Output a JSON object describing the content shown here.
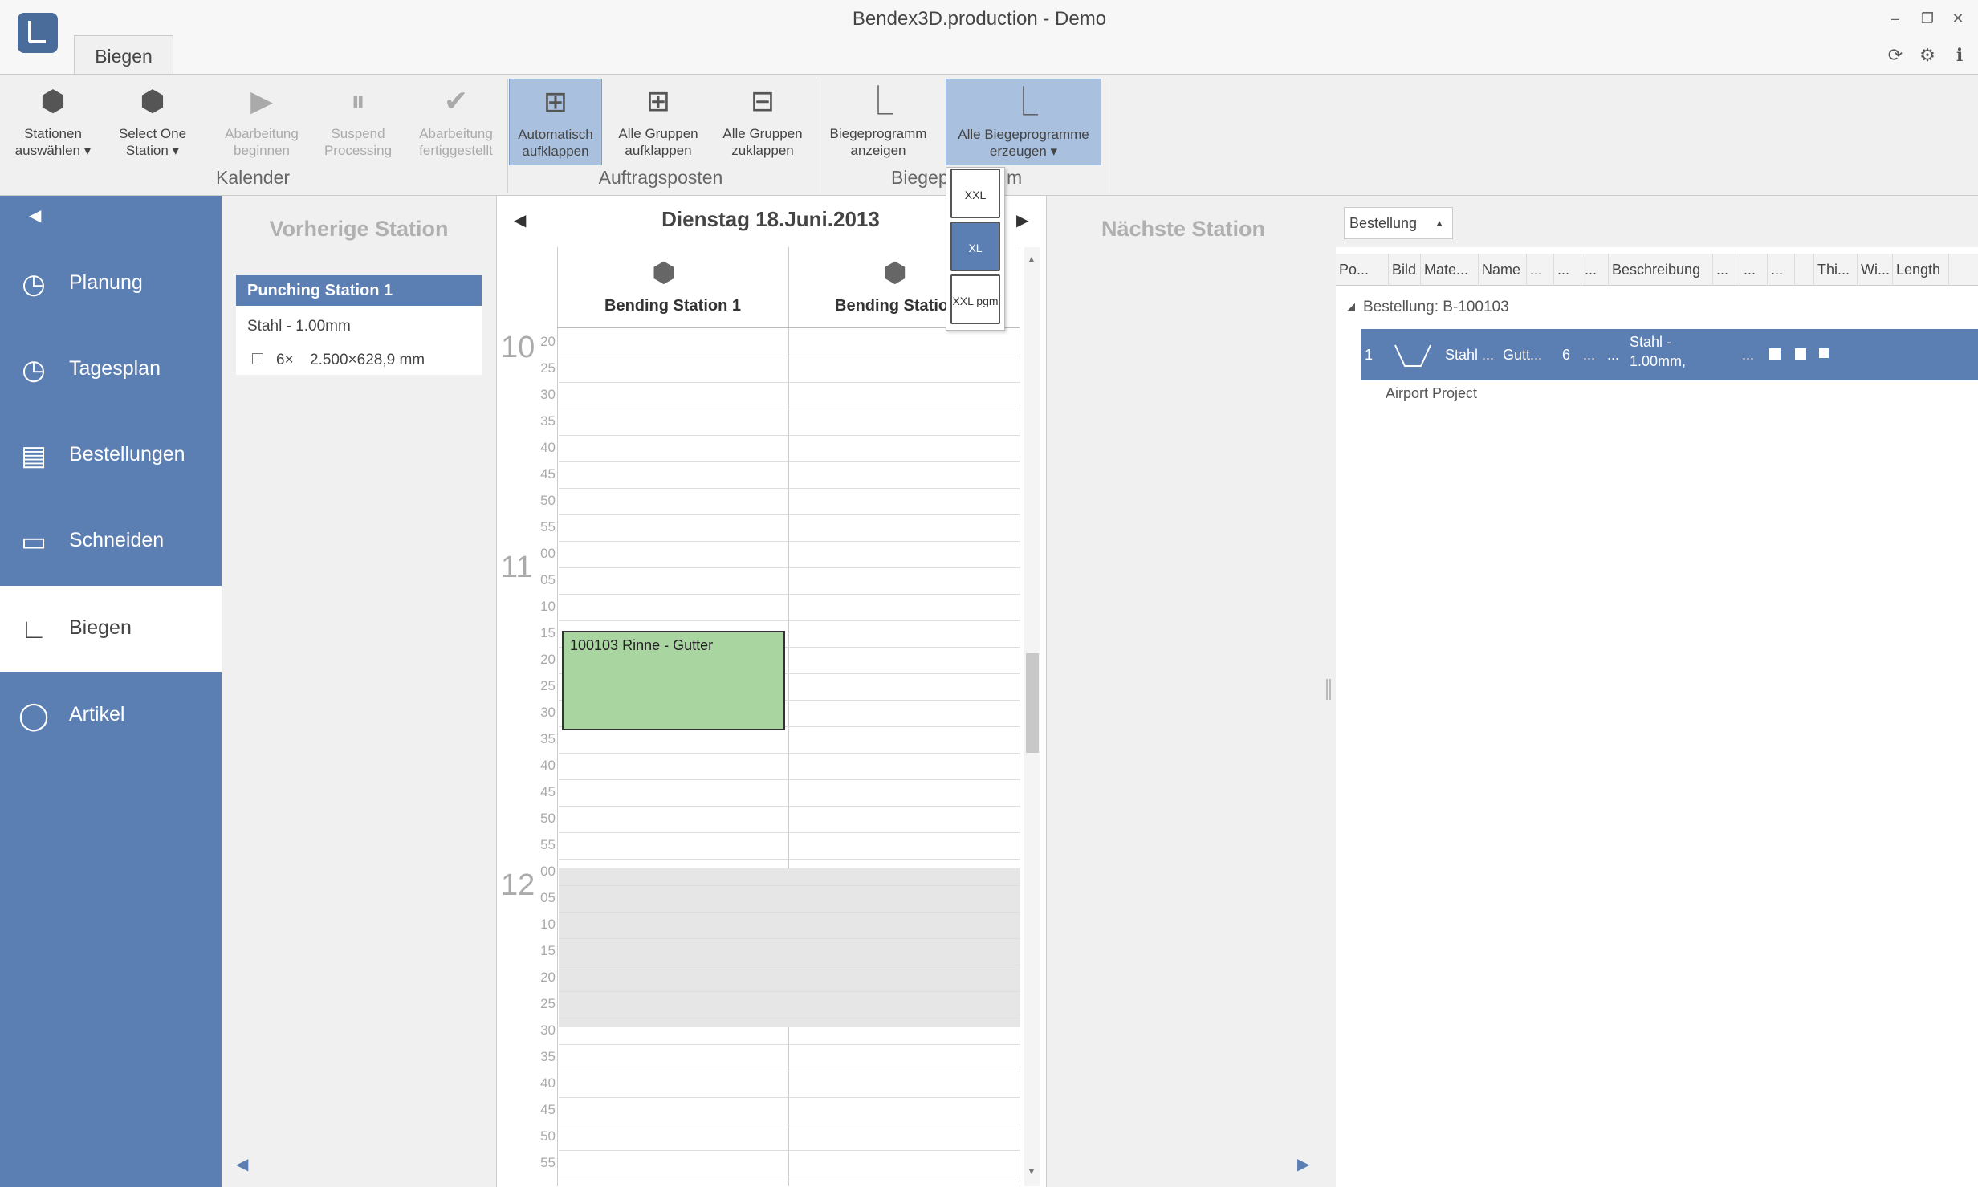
{
  "window": {
    "title": "Bendex3D.production - Demo",
    "minimize": "–",
    "restore": "❐",
    "close": "✕"
  },
  "topicons": {
    "refresh": "⟳",
    "settings": "⚙",
    "info": "ℹ"
  },
  "ribbon": {
    "tab": "Biegen",
    "buttons": [
      {
        "label1": "Stationen",
        "label2": "auswählen ▾",
        "icon": "cube-icon"
      },
      {
        "label1": "Select One",
        "label2": "Station ▾",
        "icon": "cube-icon"
      },
      {
        "label1": "Abarbeitung",
        "label2": "beginnen",
        "icon": "play-icon"
      },
      {
        "label1": "Suspend",
        "label2": "Processing",
        "icon": "pause-icon"
      },
      {
        "label1": "Abarbeitung",
        "label2": "fertiggestellt",
        "icon": "check-icon"
      },
      {
        "label1": "Automatisch",
        "label2": "aufklappen",
        "icon": "expand-icon"
      },
      {
        "label1": "Alle Gruppen",
        "label2": "aufklappen",
        "icon": "expand-all-icon"
      },
      {
        "label1": "Alle Gruppen",
        "label2": "zuklappen",
        "icon": "collapse-all-icon"
      },
      {
        "label1": "Biegeprogramm",
        "label2": "anzeigen",
        "icon": "program-icon"
      },
      {
        "label1": "Alle Biegeprogramme",
        "label2": "erzeugen ▾",
        "icon": "program-xl-icon"
      }
    ],
    "groups": [
      "Kalender",
      "Auftragsposten",
      "Biegep",
      "m"
    ]
  },
  "dropdown": {
    "items": [
      "XXL",
      "XL",
      "XXL pgm"
    ]
  },
  "sidebar": {
    "items": [
      {
        "label": "Planung",
        "icon": "clock-icon"
      },
      {
        "label": "Tagesplan",
        "icon": "clock-icon"
      },
      {
        "label": "Bestellungen",
        "icon": "document-icon"
      },
      {
        "label": "Schneiden",
        "icon": "cut-icon"
      },
      {
        "label": "Biegen",
        "icon": "bend-icon"
      },
      {
        "label": "Artikel",
        "icon": "circle-icon"
      }
    ]
  },
  "prev": {
    "title": "Vorherige Station",
    "card": {
      "header": "Punching Station 1",
      "material": "Stahl - 1.00mm",
      "qty": "6×",
      "dims": "2.500×628,9 mm"
    }
  },
  "calendar": {
    "date": "Dienstag 18.Juni.2013",
    "columns": [
      "Bending Station 1",
      "Bending Statio"
    ],
    "hours": [
      "10",
      "11",
      "12"
    ],
    "minutes10": [
      "20",
      "25",
      "30",
      "35",
      "40",
      "45",
      "50",
      "55"
    ],
    "minutes": [
      "00",
      "05",
      "10",
      "15",
      "20",
      "25",
      "30",
      "35",
      "40",
      "45",
      "50",
      "55"
    ],
    "event": "100103 Rinne - Gutter"
  },
  "next": {
    "title": "Nächste Station"
  },
  "grid": {
    "group_by": "Bestellung",
    "headers": [
      "Po...",
      "Bild",
      "Mate...",
      "Name",
      "...",
      "...",
      "...",
      "Beschreibung",
      "...",
      "...",
      "...",
      "",
      "Thi...",
      "Wi...",
      "Length"
    ],
    "group_row": "Bestellung: B-100103",
    "row": {
      "pos": "1",
      "material": "Stahl ...",
      "name": "Gutt...",
      "qty": "6",
      "dots1": "...",
      "dots2": "...",
      "desc1": "Stahl -",
      "desc2": "1.00mm,",
      "dots3": "..."
    },
    "project": "Airport Project"
  },
  "colors": {
    "sidebar": "#5b7fb3",
    "event": "#a9d5a0",
    "selected_row": "#5b7fb3"
  }
}
